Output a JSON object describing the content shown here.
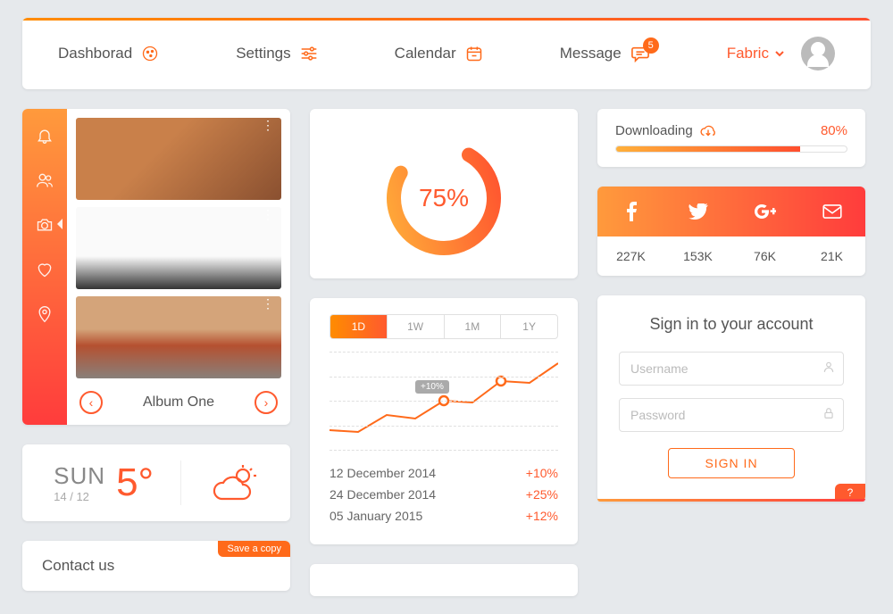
{
  "nav": {
    "dashboard": "Dashborad",
    "settings": "Settings",
    "calendar": "Calendar",
    "message": "Message",
    "message_badge": "5",
    "fabric": "Fabric"
  },
  "album": {
    "title": "Album One"
  },
  "weather": {
    "day": "SUN",
    "date": "14 / 12",
    "temp": "5°"
  },
  "contact": {
    "title": "Contact us",
    "save": "Save a copy"
  },
  "gauge": {
    "value": "75%"
  },
  "ranges": {
    "d": "1D",
    "w": "1W",
    "m": "1M",
    "y": "1Y"
  },
  "tooltip": "+10%",
  "history": [
    {
      "date": "12 December 2014",
      "val": "+10%"
    },
    {
      "date": "24 December 2014",
      "val": "+25%"
    },
    {
      "date": "05 January 2015",
      "val": "+12%"
    }
  ],
  "download": {
    "label": "Downloading",
    "pct": "80%"
  },
  "social": {
    "fb": "227K",
    "tw": "153K",
    "gp": "76K",
    "ml": "21K"
  },
  "signin": {
    "title": "Sign in to your account",
    "username_ph": "Username",
    "password_ph": "Password",
    "btn": "SIGN IN",
    "help": "?"
  },
  "chart_data": {
    "type": "line",
    "x": [
      0,
      1,
      2,
      3,
      4,
      5,
      6,
      7,
      8
    ],
    "values": [
      20,
      18,
      35,
      32,
      50,
      48,
      70,
      68,
      88
    ],
    "highlight_indices": [
      4,
      6
    ],
    "annotation": {
      "index": 4,
      "text": "+10%"
    },
    "ylim": [
      0,
      100
    ]
  }
}
